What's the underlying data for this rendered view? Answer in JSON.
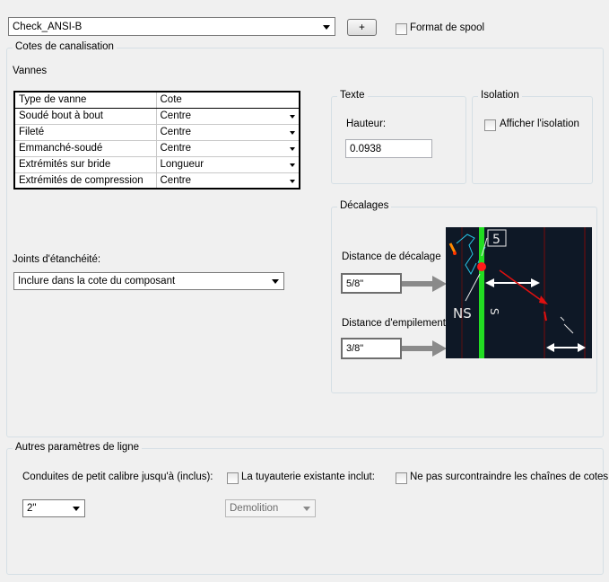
{
  "header": {
    "profile_value": "Check_ANSI-B",
    "add_button": "+",
    "spool_format_label": "Format de spool"
  },
  "pipe_dims": {
    "title": "Cotes de canalisation",
    "valves_label": "Vannes",
    "table": {
      "columns": [
        "Type de vanne",
        "Cote"
      ],
      "rows": [
        {
          "type": "Soudé bout à bout",
          "cote": "Centre"
        },
        {
          "type": "Fileté",
          "cote": "Centre"
        },
        {
          "type": "Emmanché-soudé",
          "cote": "Centre"
        },
        {
          "type": "Extrémités sur bride",
          "cote": "Longueur"
        },
        {
          "type": "Extrémités de compression",
          "cote": "Centre"
        }
      ]
    },
    "seals_label": "Joints d'étanchéité:",
    "seals_value": "Inclure dans la cote du composant",
    "text_group": {
      "title": "Texte",
      "height_label": "Hauteur:",
      "height_value": "0.0938"
    },
    "insulation_group": {
      "title": "Isolation",
      "show_label": "Afficher l'isolation"
    },
    "offsets_group": {
      "title": "Décalages",
      "offset_label": "Distance de décalage",
      "offset_value": "5/8\"",
      "stack_label": "Distance d'empilement",
      "stack_value": "3/8\"",
      "preview_tag": "5",
      "preview_ns": "NS"
    }
  },
  "line_params": {
    "title": "Autres paramètres de ligne",
    "small_bore_label": "Conduites de petit calibre jusqu'à (inclus):",
    "small_bore_value": "2\"",
    "existing_pipe_label": "La tuyauterie existante inclut:",
    "existing_pipe_value": "Demolition",
    "no_overconstrain_label": "Ne pas surcontraindre les chaînes de cotes"
  },
  "colors": {
    "window_bg": "#f0f0f0",
    "preview_bg": "#0e1826",
    "pipe_green": "#22dd22",
    "marker_red": "#e01010",
    "arrow_gray": "#8a8a8a"
  }
}
